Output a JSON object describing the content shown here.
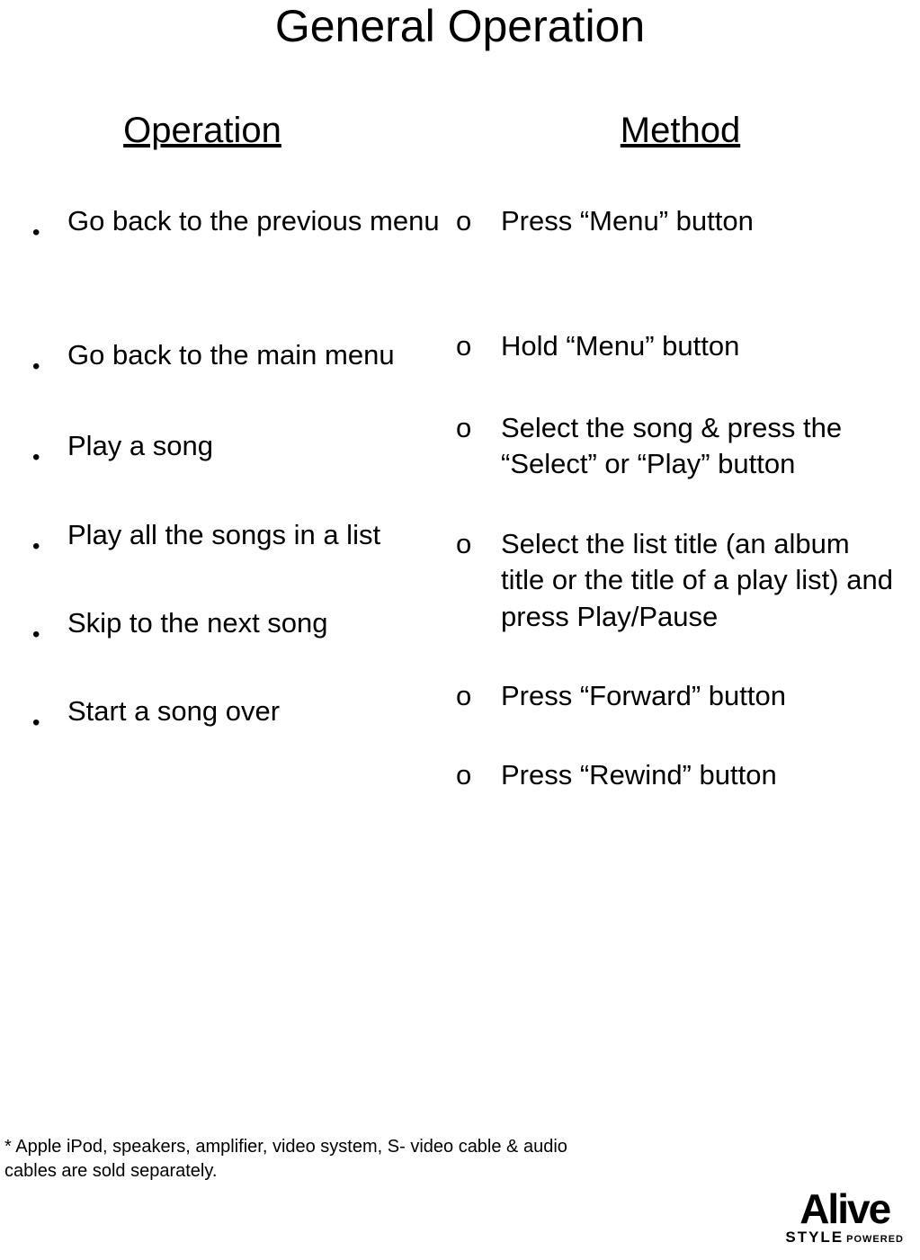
{
  "title": "General Operation",
  "columns": {
    "left_heading": "Operation",
    "right_heading": "Method"
  },
  "rows": [
    {
      "operation": "Go back to the previous menu",
      "method": "Press “Menu” button"
    },
    {
      "operation": "Go back to the main menu",
      "method": "Hold “Menu” button"
    },
    {
      "operation": "Play a song",
      "method": "Select the song & press the “Select” or “Play” button"
    },
    {
      "operation": "Play all the songs in a list",
      "method": "Select the list title (an album title or the title of a play list) and press Play/Pause"
    },
    {
      "operation": "Skip to the next song",
      "method": "Press “Forward” button"
    },
    {
      "operation": "Start a song over",
      "method": "Press “Rewind” button"
    }
  ],
  "list_markers": {
    "circle": "o"
  },
  "footnote": "* Apple iPod, speakers, amplifier, video system, S- video cable & audio cables are sold separately.",
  "logo": {
    "line1": "Alive",
    "line2": "STYLE",
    "line2_suffix": "POWERED"
  }
}
